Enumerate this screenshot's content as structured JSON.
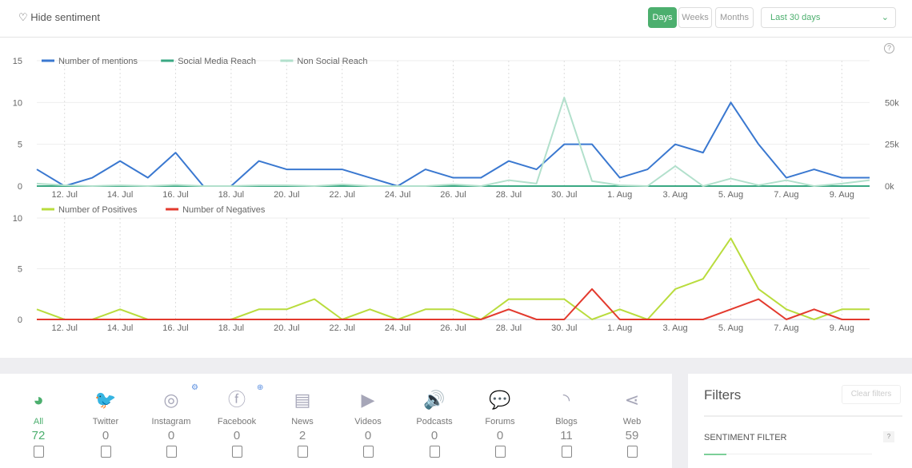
{
  "header": {
    "hide_sentiment": "Hide sentiment",
    "periods": [
      "Days",
      "Weeks",
      "Months"
    ],
    "active_period": "Days",
    "range": "Last 30 days",
    "help": "?"
  },
  "colors": {
    "mentions": "#3a78d0",
    "social_reach": "#3aa883",
    "non_social_reach": "#b2e0cc",
    "positives": "#b9dc3d",
    "negatives": "#e33a2e",
    "accent": "#4caf6e"
  },
  "chart_data": [
    {
      "type": "line",
      "x": [
        "11. Jul",
        "12. Jul",
        "13. Jul",
        "14. Jul",
        "15. Jul",
        "16. Jul",
        "17. Jul",
        "18. Jul",
        "19. Jul",
        "20. Jul",
        "21. Jul",
        "22. Jul",
        "23. Jul",
        "24. Jul",
        "25. Jul",
        "26. Jul",
        "27. Jul",
        "28. Jul",
        "29. Jul",
        "30. Jul",
        "31. Jul",
        "1. Aug",
        "2. Aug",
        "3. Aug",
        "4. Aug",
        "5. Aug",
        "6. Aug",
        "7. Aug",
        "8. Aug",
        "9. Aug",
        "10. Aug"
      ],
      "xticks": [
        "12. Jul",
        "14. Jul",
        "16. Jul",
        "18. Jul",
        "20. Jul",
        "22. Jul",
        "24. Jul",
        "26. Jul",
        "28. Jul",
        "30. Jul",
        "1. Aug",
        "3. Aug",
        "5. Aug",
        "7. Aug",
        "9. Aug"
      ],
      "ylim": [
        0,
        15
      ],
      "yticks": [
        "0",
        "5",
        "10",
        "15"
      ],
      "y2lim": [
        0,
        75000
      ],
      "y2ticks": [
        "0k",
        "25k",
        "50k"
      ],
      "legend": "top-left",
      "series": [
        {
          "name": "Number of mentions",
          "axis": "left",
          "values": [
            2,
            0,
            1,
            3,
            1,
            4,
            0,
            0,
            3,
            2,
            2,
            2,
            1,
            0,
            2,
            1,
            1,
            3,
            2,
            5,
            5,
            1,
            2,
            5,
            4,
            10,
            5,
            1,
            2,
            1,
            1
          ]
        },
        {
          "name": "Social Media Reach",
          "axis": "right",
          "values": [
            0,
            0,
            0,
            0,
            0,
            0,
            0,
            0,
            0,
            0,
            0,
            0,
            0,
            0,
            0,
            0,
            0,
            0,
            0,
            0,
            0,
            0,
            0,
            0,
            0,
            0,
            0,
            0,
            0,
            0,
            0
          ]
        },
        {
          "name": "Non Social Reach",
          "axis": "right",
          "values": [
            1500,
            500,
            0,
            500,
            0,
            800,
            0,
            0,
            500,
            500,
            0,
            1000,
            0,
            0,
            0,
            1000,
            0,
            3500,
            1500,
            53000,
            3000,
            500,
            0,
            12000,
            0,
            4500,
            500,
            3500,
            0,
            1500,
            3500
          ]
        }
      ]
    },
    {
      "type": "line",
      "x": [
        "11. Jul",
        "12. Jul",
        "13. Jul",
        "14. Jul",
        "15. Jul",
        "16. Jul",
        "17. Jul",
        "18. Jul",
        "19. Jul",
        "20. Jul",
        "21. Jul",
        "22. Jul",
        "23. Jul",
        "24. Jul",
        "25. Jul",
        "26. Jul",
        "27. Jul",
        "28. Jul",
        "29. Jul",
        "30. Jul",
        "31. Jul",
        "1. Aug",
        "2. Aug",
        "3. Aug",
        "4. Aug",
        "5. Aug",
        "6. Aug",
        "7. Aug",
        "8. Aug",
        "9. Aug",
        "10. Aug"
      ],
      "xticks": [
        "12. Jul",
        "14. Jul",
        "16. Jul",
        "18. Jul",
        "20. Jul",
        "22. Jul",
        "24. Jul",
        "26. Jul",
        "28. Jul",
        "30. Jul",
        "1. Aug",
        "3. Aug",
        "5. Aug",
        "7. Aug",
        "9. Aug"
      ],
      "ylim": [
        0,
        10
      ],
      "yticks": [
        "0",
        "5",
        "10"
      ],
      "legend": "top-left",
      "series": [
        {
          "name": "Number of Positives",
          "values": [
            1,
            0,
            0,
            1,
            0,
            0,
            0,
            0,
            1,
            1,
            2,
            0,
            1,
            0,
            1,
            1,
            0,
            2,
            2,
            2,
            0,
            1,
            0,
            3,
            4,
            8,
            3,
            1,
            0,
            1,
            1
          ]
        },
        {
          "name": "Number of Negatives",
          "values": [
            0,
            0,
            0,
            0,
            0,
            0,
            0,
            0,
            0,
            0,
            0,
            0,
            0,
            0,
            0,
            0,
            0,
            1,
            0,
            0,
            3,
            0,
            0,
            0,
            0,
            1,
            2,
            0,
            1,
            0,
            0
          ]
        }
      ]
    }
  ],
  "sources": [
    {
      "label": "All",
      "count": "72",
      "icon": "globe-icon",
      "glyph": "◕",
      "active": true
    },
    {
      "label": "Twitter",
      "count": "0",
      "icon": "twitter-icon",
      "glyph": "🐦"
    },
    {
      "label": "Instagram",
      "count": "0",
      "icon": "instagram-icon",
      "glyph": "◎",
      "badge": "⚙"
    },
    {
      "label": "Facebook",
      "count": "0",
      "icon": "facebook-icon",
      "glyph": "ⓕ",
      "badge": "⊕"
    },
    {
      "label": "News",
      "count": "2",
      "icon": "news-icon",
      "glyph": "▤"
    },
    {
      "label": "Videos",
      "count": "0",
      "icon": "play-icon",
      "glyph": "▶"
    },
    {
      "label": "Podcasts",
      "count": "0",
      "icon": "speaker-icon",
      "glyph": "🔊"
    },
    {
      "label": "Forums",
      "count": "0",
      "icon": "chat-icon",
      "glyph": "💬"
    },
    {
      "label": "Blogs",
      "count": "11",
      "icon": "rss-icon",
      "glyph": "◝"
    },
    {
      "label": "Web",
      "count": "59",
      "icon": "share-icon",
      "glyph": "⋖"
    }
  ],
  "filters": {
    "title": "Filters",
    "clear": "Clear filters",
    "sentiment": "SENTIMENT FILTER",
    "help": "?"
  }
}
